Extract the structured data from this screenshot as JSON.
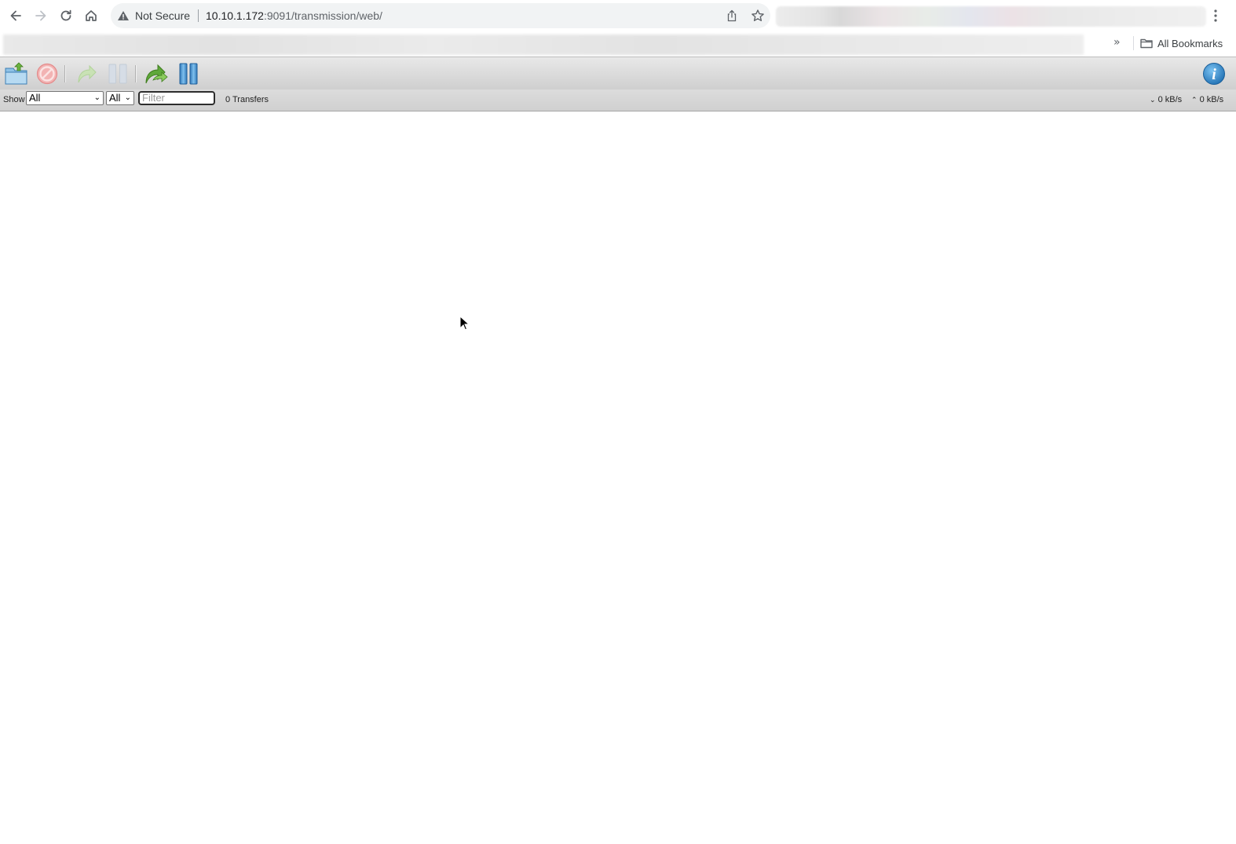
{
  "browser": {
    "security_label": "Not Secure",
    "url_host": "10.10.1.172",
    "url_path": ":9091/transmission/web/",
    "bookmarks_overflow": "»",
    "all_bookmarks_label": "All Bookmarks"
  },
  "toolbar": {
    "buttons": [
      {
        "name": "open-torrent-icon",
        "enabled": true
      },
      {
        "name": "remove-torrent-icon",
        "enabled": false
      },
      {
        "name": "resume-selected-icon",
        "enabled": false
      },
      {
        "name": "pause-selected-icon",
        "enabled": false
      },
      {
        "name": "resume-all-icon",
        "enabled": true
      },
      {
        "name": "pause-all-icon",
        "enabled": true
      },
      {
        "name": "inspector-info-icon",
        "enabled": true
      }
    ]
  },
  "filterbar": {
    "show_label": "Show",
    "status_filter": "All",
    "tracker_filter": "All",
    "filter_placeholder": "Filter",
    "transfers_count": "0 Transfers",
    "download_speed": "0 kB/s",
    "upload_speed": "0 kB/s"
  },
  "colors": {
    "toolbar_top": "#e8e8e8",
    "toolbar_bottom": "#cfcfcf",
    "info_blue": "#2a86c8",
    "resume_green": "#5fa83a"
  }
}
